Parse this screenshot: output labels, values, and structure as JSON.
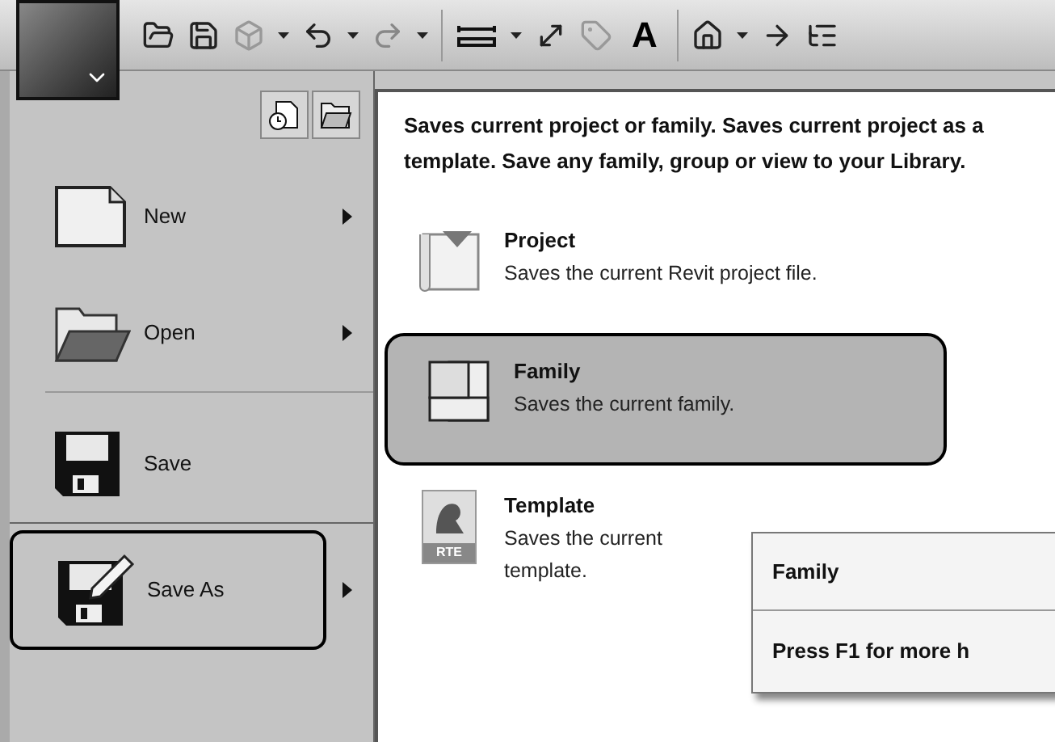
{
  "toolbar": {
    "text_tool_label": "A"
  },
  "left_menu": [
    {
      "kind": "new",
      "label": "New",
      "has_submenu": true,
      "selected": false
    },
    {
      "kind": "open",
      "label": "Open",
      "has_submenu": true,
      "selected": false
    },
    {
      "kind": "save",
      "label": "Save",
      "has_submenu": false,
      "selected": false
    },
    {
      "kind": "saveas",
      "label": "Save As",
      "has_submenu": true,
      "selected": true
    }
  ],
  "submenu": {
    "header": "Saves current project or family. Saves current project as a template. Save any family, group or view to your Library.",
    "items": [
      {
        "kind": "project",
        "title": "Project",
        "description": "Saves the current Revit project file.",
        "selected": false
      },
      {
        "kind": "family",
        "title": "Family",
        "description": "Saves the current family.",
        "selected": true
      },
      {
        "kind": "template",
        "title": "Template",
        "description": "Saves the current template.",
        "icon_label": "RTE",
        "selected": false
      }
    ]
  },
  "tooltip": {
    "title": "Family",
    "help": "Press F1 for more h"
  }
}
